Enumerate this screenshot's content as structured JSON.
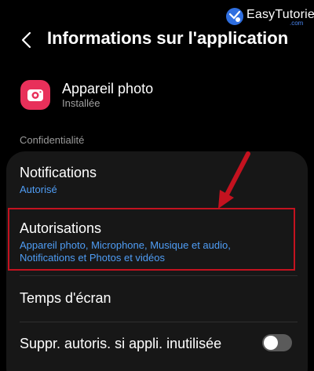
{
  "watermark": {
    "text": "EasyTutoriel",
    "suffix": ".com"
  },
  "header": {
    "title": "Informations sur l'application",
    "back_icon": "chevron-left-icon"
  },
  "app": {
    "name": "Appareil photo",
    "status": "Installée",
    "icon": "camera-app-icon",
    "icon_color": "#e8305a"
  },
  "privacy": {
    "section_label": "Confidentialité",
    "items": [
      {
        "title": "Notifications",
        "subtitle": "Autorisé"
      },
      {
        "title": "Autorisations",
        "subtitle": "Appareil photo, Microphone, Musique et audio, Notifications et Photos et vidéos"
      },
      {
        "title": "Temps d'écran"
      },
      {
        "title": "Suppr. autoris. si appli. inutilisée",
        "toggle": false
      }
    ]
  },
  "colors": {
    "accent": "#4f9df5",
    "highlight": "#c4121f",
    "background": "#000000",
    "card": "#171717"
  }
}
